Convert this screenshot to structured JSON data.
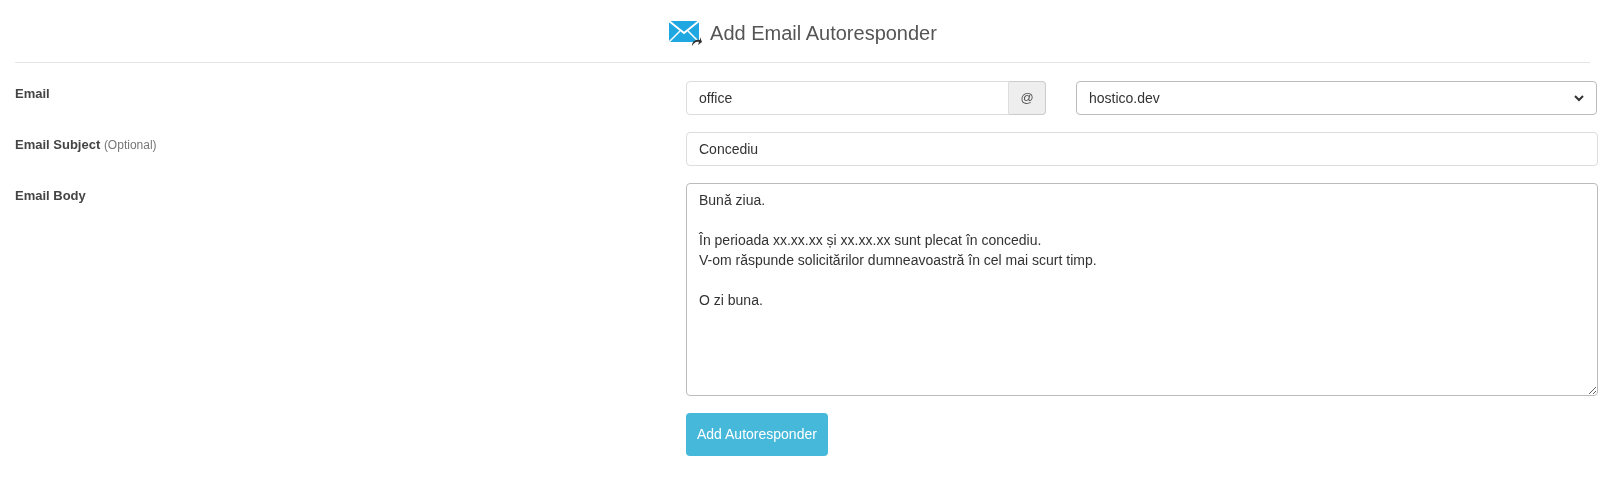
{
  "title": "Add Email Autoresponder",
  "email": {
    "label": "Email",
    "value": "office",
    "at": "@",
    "domain": "hostico.dev"
  },
  "subject": {
    "label": "Email Subject",
    "hint": "(Optional)",
    "value": "Concediu"
  },
  "body": {
    "label": "Email Body",
    "value": "Bună ziua.\n\nÎn perioada xx.xx.xx și xx.xx.xx sunt plecat în concediu.\nV-om răspunde solicitărilor dumneavoastră în cel mai scurt timp.\n\nO zi buna."
  },
  "submit": "Add Autoresponder"
}
